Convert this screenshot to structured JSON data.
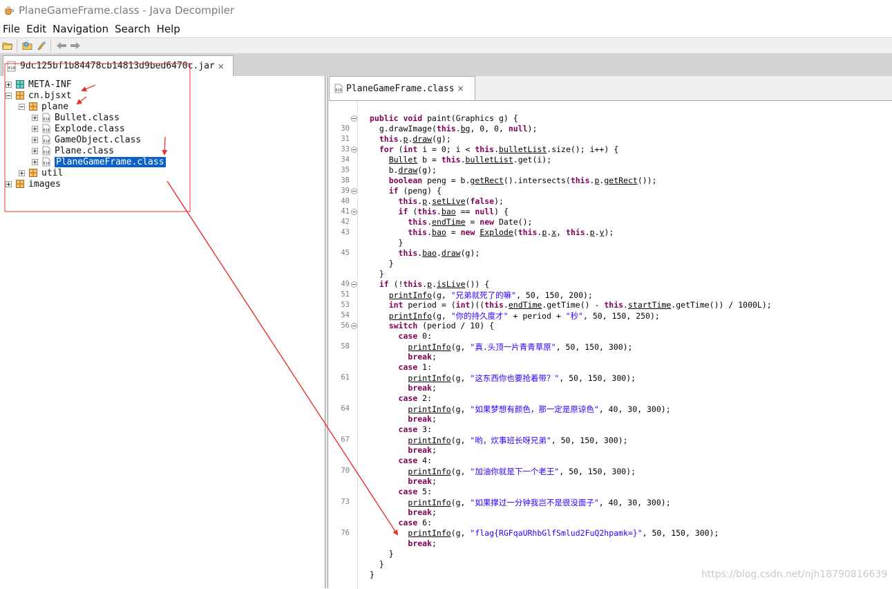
{
  "window": {
    "title": "PlaneGameFrame.class - Java Decompiler",
    "app_icon": "coffee-cup-icon"
  },
  "menu": [
    "File",
    "Edit",
    "Navigation",
    "Search",
    "Help"
  ],
  "toolbar": {
    "icons": [
      "open-file-icon",
      "open-type-icon",
      "search-icon",
      "back-arrow-icon",
      "forward-arrow-icon"
    ]
  },
  "jar_tab": {
    "label": "9dc125bf1b84478cb14813d9bed6470c.jar",
    "close": "×"
  },
  "tree": {
    "items": [
      {
        "label": "META-INF"
      },
      {
        "label": "cn.bjsxt"
      },
      {
        "label": "plane"
      },
      {
        "label": "Bullet.class"
      },
      {
        "label": "Explode.class"
      },
      {
        "label": "GameObject.class"
      },
      {
        "label": "Plane.class"
      },
      {
        "label": "PlaneGameFrame.class",
        "selected": true
      },
      {
        "label": "util"
      },
      {
        "label": "images"
      }
    ]
  },
  "editor_tab": {
    "label": "PlaneGameFrame.class",
    "close": "×"
  },
  "code": {
    "line_numbers": [
      "",
      "30",
      "31",
      "33",
      "34",
      "35",
      "38",
      "39",
      "40",
      "41",
      "42",
      "43",
      "",
      "45",
      "",
      "",
      "49",
      "51",
      "53",
      "54",
      "56",
      "",
      "58",
      "",
      "",
      "61",
      "",
      "",
      "64",
      "",
      "",
      "67",
      "",
      "",
      "70",
      "",
      "",
      "73",
      "",
      "",
      "76",
      "",
      "",
      "",
      ""
    ],
    "lines": [
      [
        [
          "kw",
          "public void"
        ],
        [
          "n",
          " paint(Graphics g) {"
        ]
      ],
      [
        [
          "n",
          "  g.drawImage("
        ],
        [
          "kw",
          "this"
        ],
        [
          "n",
          "."
        ],
        [
          "u",
          "bg"
        ],
        [
          "n",
          ", 0, 0, "
        ],
        [
          "kw",
          "null"
        ],
        [
          "n",
          ");"
        ]
      ],
      [
        [
          "n",
          "  "
        ],
        [
          "kw",
          "this"
        ],
        [
          "n",
          "."
        ],
        [
          "u",
          "p"
        ],
        [
          "n",
          "."
        ],
        [
          "u",
          "draw"
        ],
        [
          "n",
          "(g);"
        ]
      ],
      [
        [
          "n",
          "  "
        ],
        [
          "kw",
          "for"
        ],
        [
          "n",
          " ("
        ],
        [
          "kw",
          "int"
        ],
        [
          "n",
          " i = 0; i < "
        ],
        [
          "kw",
          "this"
        ],
        [
          "n",
          "."
        ],
        [
          "u",
          "bulletList"
        ],
        [
          "n",
          ".size(); i++) {"
        ]
      ],
      [
        [
          "n",
          "    "
        ],
        [
          "u",
          "Bullet"
        ],
        [
          "n",
          " b = "
        ],
        [
          "kw",
          "this"
        ],
        [
          "n",
          "."
        ],
        [
          "u",
          "bulletList"
        ],
        [
          "n",
          ".get(i);"
        ]
      ],
      [
        [
          "n",
          "    b."
        ],
        [
          "u",
          "draw"
        ],
        [
          "n",
          "(g);"
        ]
      ],
      [
        [
          "n",
          "    "
        ],
        [
          "kw",
          "boolean"
        ],
        [
          "n",
          " peng = b."
        ],
        [
          "u",
          "getRect"
        ],
        [
          "n",
          "().intersects("
        ],
        [
          "kw",
          "this"
        ],
        [
          "n",
          "."
        ],
        [
          "u",
          "p"
        ],
        [
          "n",
          "."
        ],
        [
          "u",
          "getRect"
        ],
        [
          "n",
          "());"
        ]
      ],
      [
        [
          "n",
          "    "
        ],
        [
          "kw",
          "if"
        ],
        [
          "n",
          " (peng) {"
        ]
      ],
      [
        [
          "n",
          "      "
        ],
        [
          "kw",
          "this"
        ],
        [
          "n",
          "."
        ],
        [
          "u",
          "p"
        ],
        [
          "n",
          "."
        ],
        [
          "u",
          "setLive"
        ],
        [
          "n",
          "("
        ],
        [
          "kw",
          "false"
        ],
        [
          "n",
          ");"
        ]
      ],
      [
        [
          "n",
          "      "
        ],
        [
          "kw",
          "if"
        ],
        [
          "n",
          " ("
        ],
        [
          "kw",
          "this"
        ],
        [
          "n",
          "."
        ],
        [
          "u",
          "bao"
        ],
        [
          "n",
          " == "
        ],
        [
          "kw",
          "null"
        ],
        [
          "n",
          ") {"
        ]
      ],
      [
        [
          "n",
          "        "
        ],
        [
          "kw",
          "this"
        ],
        [
          "n",
          "."
        ],
        [
          "u",
          "endTime"
        ],
        [
          "n",
          " = "
        ],
        [
          "kw",
          "new"
        ],
        [
          "n",
          " Date();"
        ]
      ],
      [
        [
          "n",
          "        "
        ],
        [
          "kw",
          "this"
        ],
        [
          "n",
          "."
        ],
        [
          "u",
          "bao"
        ],
        [
          "n",
          " = "
        ],
        [
          "kw",
          "new"
        ],
        [
          "n",
          " "
        ],
        [
          "u",
          "Explode"
        ],
        [
          "n",
          "("
        ],
        [
          "kw",
          "this"
        ],
        [
          "n",
          "."
        ],
        [
          "u",
          "p"
        ],
        [
          "n",
          "."
        ],
        [
          "u",
          "x"
        ],
        [
          "n",
          ", "
        ],
        [
          "kw",
          "this"
        ],
        [
          "n",
          "."
        ],
        [
          "u",
          "p"
        ],
        [
          "n",
          "."
        ],
        [
          "u",
          "y"
        ],
        [
          "n",
          ");"
        ]
      ],
      [
        [
          "n",
          "      }"
        ]
      ],
      [
        [
          "n",
          "      "
        ],
        [
          "kw",
          "this"
        ],
        [
          "n",
          "."
        ],
        [
          "u",
          "bao"
        ],
        [
          "n",
          "."
        ],
        [
          "u",
          "draw"
        ],
        [
          "n",
          "(g);"
        ]
      ],
      [
        [
          "n",
          "    }"
        ]
      ],
      [
        [
          "n",
          "  }"
        ]
      ],
      [
        [
          "n",
          "  "
        ],
        [
          "kw",
          "if"
        ],
        [
          "n",
          " (!"
        ],
        [
          "kw",
          "this"
        ],
        [
          "n",
          "."
        ],
        [
          "u",
          "p"
        ],
        [
          "n",
          "."
        ],
        [
          "u",
          "isLive"
        ],
        [
          "n",
          "()) {"
        ]
      ],
      [
        [
          "n",
          "    "
        ],
        [
          "u",
          "printInfo"
        ],
        [
          "n",
          "(g, "
        ],
        [
          "st",
          "\"兄弟就死了的嘛\""
        ],
        [
          "n",
          ", 50, 150, 200);"
        ]
      ],
      [
        [
          "n",
          "    "
        ],
        [
          "kw",
          "int"
        ],
        [
          "n",
          " period = ("
        ],
        [
          "kw",
          "int"
        ],
        [
          "n",
          ")(("
        ],
        [
          "kw",
          "this"
        ],
        [
          "n",
          "."
        ],
        [
          "u",
          "endTime"
        ],
        [
          "n",
          ".getTime() - "
        ],
        [
          "kw",
          "this"
        ],
        [
          "n",
          "."
        ],
        [
          "u",
          "startTime"
        ],
        [
          "n",
          ".getTime()) / 1000L);"
        ]
      ],
      [
        [
          "n",
          "    "
        ],
        [
          "u",
          "printInfo"
        ],
        [
          "n",
          "(g, "
        ],
        [
          "st",
          "\"你的持久度才\""
        ],
        [
          "n",
          " + period + "
        ],
        [
          "st",
          "\"秒\""
        ],
        [
          "n",
          ", 50, 150, 250);"
        ]
      ],
      [
        [
          "n",
          "    "
        ],
        [
          "kw",
          "switch"
        ],
        [
          "n",
          " (period / 10) {"
        ]
      ],
      [
        [
          "n",
          "      "
        ],
        [
          "kw",
          "case"
        ],
        [
          "n",
          " 0:"
        ]
      ],
      [
        [
          "n",
          "        "
        ],
        [
          "u",
          "printInfo"
        ],
        [
          "n",
          "(g, "
        ],
        [
          "st",
          "\"真.头顶一片青青草原\""
        ],
        [
          "n",
          ", 50, 150, 300);"
        ]
      ],
      [
        [
          "n",
          "        "
        ],
        [
          "kw",
          "break"
        ],
        [
          "n",
          ";"
        ]
      ],
      [
        [
          "n",
          "      "
        ],
        [
          "kw",
          "case"
        ],
        [
          "n",
          " 1:"
        ]
      ],
      [
        [
          "n",
          "        "
        ],
        [
          "u",
          "printInfo"
        ],
        [
          "n",
          "(g, "
        ],
        [
          "st",
          "\"这东西你也要抢着带？\""
        ],
        [
          "n",
          ", 50, 150, 300);"
        ]
      ],
      [
        [
          "n",
          "        "
        ],
        [
          "kw",
          "break"
        ],
        [
          "n",
          ";"
        ]
      ],
      [
        [
          "n",
          "      "
        ],
        [
          "kw",
          "case"
        ],
        [
          "n",
          " 2:"
        ]
      ],
      [
        [
          "n",
          "        "
        ],
        [
          "u",
          "printInfo"
        ],
        [
          "n",
          "(g, "
        ],
        [
          "st",
          "\"如果梦想有颜色，那一定是原谅色\""
        ],
        [
          "n",
          ", 40, 30, 300);"
        ]
      ],
      [
        [
          "n",
          "        "
        ],
        [
          "kw",
          "break"
        ],
        [
          "n",
          ";"
        ]
      ],
      [
        [
          "n",
          "      "
        ],
        [
          "kw",
          "case"
        ],
        [
          "n",
          " 3:"
        ]
      ],
      [
        [
          "n",
          "        "
        ],
        [
          "u",
          "printInfo"
        ],
        [
          "n",
          "(g, "
        ],
        [
          "st",
          "\"哟，炊事班长呀兄弟\""
        ],
        [
          "n",
          ", 50, 150, 300);"
        ]
      ],
      [
        [
          "n",
          "        "
        ],
        [
          "kw",
          "break"
        ],
        [
          "n",
          ";"
        ]
      ],
      [
        [
          "n",
          "      "
        ],
        [
          "kw",
          "case"
        ],
        [
          "n",
          " 4:"
        ]
      ],
      [
        [
          "n",
          "        "
        ],
        [
          "u",
          "printInfo"
        ],
        [
          "n",
          "(g, "
        ],
        [
          "st",
          "\"加油你就是下一个老王\""
        ],
        [
          "n",
          ", 50, 150, 300);"
        ]
      ],
      [
        [
          "n",
          "        "
        ],
        [
          "kw",
          "break"
        ],
        [
          "n",
          ";"
        ]
      ],
      [
        [
          "n",
          "      "
        ],
        [
          "kw",
          "case"
        ],
        [
          "n",
          " 5:"
        ]
      ],
      [
        [
          "n",
          "        "
        ],
        [
          "u",
          "printInfo"
        ],
        [
          "n",
          "(g, "
        ],
        [
          "st",
          "\"如果撑过一分钟我岂不是很没面子\""
        ],
        [
          "n",
          ", 40, 30, 300);"
        ]
      ],
      [
        [
          "n",
          "        "
        ],
        [
          "kw",
          "break"
        ],
        [
          "n",
          ";"
        ]
      ],
      [
        [
          "n",
          "      "
        ],
        [
          "kw",
          "case"
        ],
        [
          "n",
          " 6:"
        ]
      ],
      [
        [
          "n",
          "        "
        ],
        [
          "u",
          "printInfo"
        ],
        [
          "n",
          "(g, "
        ],
        [
          "st",
          "\"flag{RGFqaURhbGlfSmlud2FuQ2hpamk=}\""
        ],
        [
          "n",
          ", 50, 150, 300);"
        ]
      ],
      [
        [
          "n",
          "        "
        ],
        [
          "kw",
          "break"
        ],
        [
          "n",
          ";"
        ]
      ],
      [
        [
          "n",
          "    }"
        ]
      ],
      [
        [
          "n",
          "  }"
        ]
      ],
      [
        [
          "n",
          "}"
        ]
      ]
    ],
    "fold_rows": [
      0,
      3,
      7,
      9,
      16,
      20
    ]
  },
  "watermark": "https://blog.csdn.net/njh18790816639",
  "colors": {
    "keyword": "#7f0055",
    "string": "#2a00ff",
    "selection": "#0b61c8",
    "annotation": "#e8322b"
  }
}
